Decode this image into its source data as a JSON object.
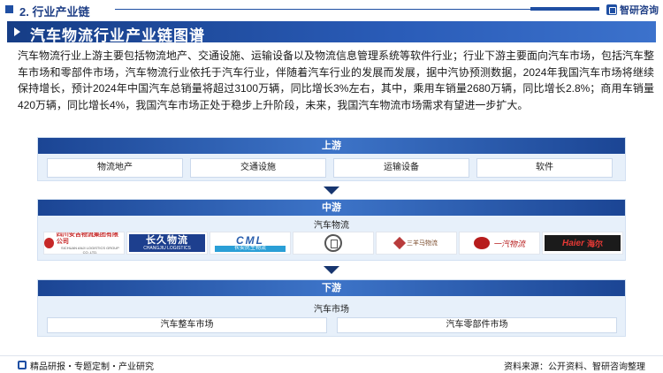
{
  "header": {
    "section_title": "2. 行业产业链",
    "brand": "智研咨询"
  },
  "title": "汽车物流行业产业链图谱",
  "paragraph": "汽车物流行业上游主要包括物流地产、交通设施、运输设备以及物流信息管理系统等软件行业；行业下游主要面向汽车市场，包括汽车整车市场和零部件市场，汽车物流行业依托于汽车行业，伴随着汽车行业的发展而发展，据中汽协预测数据，2024年我国汽车市场将继续保持增长，预计2024年中国汽车总销量将超过3100万辆，同比增长3%左右，其中，乘用车销量2680万辆，同比增长2.8%；商用车销量420万辆，同比增长4%，我国汽车市场正处于稳步上升阶段，未来，我国汽车物流市场需求有望进一步扩大。",
  "upstream": {
    "label": "上游",
    "items": [
      "物流地产",
      "交通设施",
      "运输设备",
      "软件"
    ]
  },
  "midstream": {
    "label": "中游",
    "sub_label": "汽车物流",
    "logos": [
      {
        "name": "四川安吉物流集团有限公司",
        "sub": "SICHUAN ANJI LOGISTICS GROUP CO.,LTD."
      },
      {
        "name": "长久物流",
        "sub": "CHANGJIU LOGISTICS"
      },
      {
        "name": "CML",
        "sub": "长安民生物流"
      },
      {
        "name": "round-logo"
      },
      {
        "name": "三羊马物流"
      },
      {
        "name": "一汽物流"
      },
      {
        "name": "Haier",
        "sub": "海尔"
      }
    ]
  },
  "downstream": {
    "label": "下游",
    "sub_label": "汽车市场",
    "items": [
      "汽车整车市场",
      "汽车零部件市场"
    ]
  },
  "footer": {
    "left": "精品研报・专题定制・产业研究",
    "right": "资料来源：公开资料、智研咨询整理"
  }
}
